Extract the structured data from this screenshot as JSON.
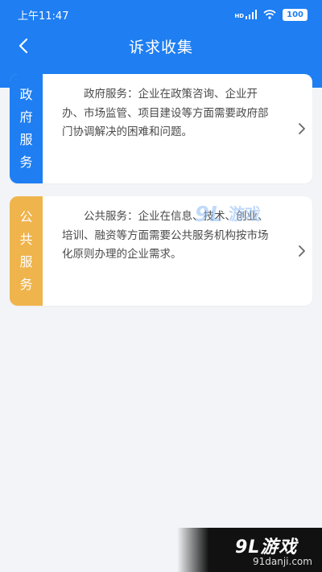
{
  "status_bar": {
    "time": "上午11:47",
    "hd_label": "HD",
    "battery": "100"
  },
  "header": {
    "title": "诉求收集",
    "back_icon": "chevron-left-icon"
  },
  "cards": [
    {
      "tab_chars": [
        "政",
        "府",
        "服",
        "务"
      ],
      "description": "政府服务：企业在政策咨询、企业开办、市场监管、项目建设等方面需要政府部门协调解决的困难和问题。",
      "tab_color": "#1e7ef2"
    },
    {
      "tab_chars": [
        "公",
        "共",
        "服",
        "务"
      ],
      "description": "公共服务：企业在信息、技术、创业、培训、融资等方面需要公共服务机构按市场化原则办理的企业需求。",
      "tab_color": "#f0b44c"
    }
  ],
  "watermark": {
    "logo_text": "9L游戏",
    "site": "91danji.com"
  },
  "colors": {
    "primary": "#1e7ef2",
    "accent": "#f0b44c",
    "background": "#f2f4f7"
  }
}
